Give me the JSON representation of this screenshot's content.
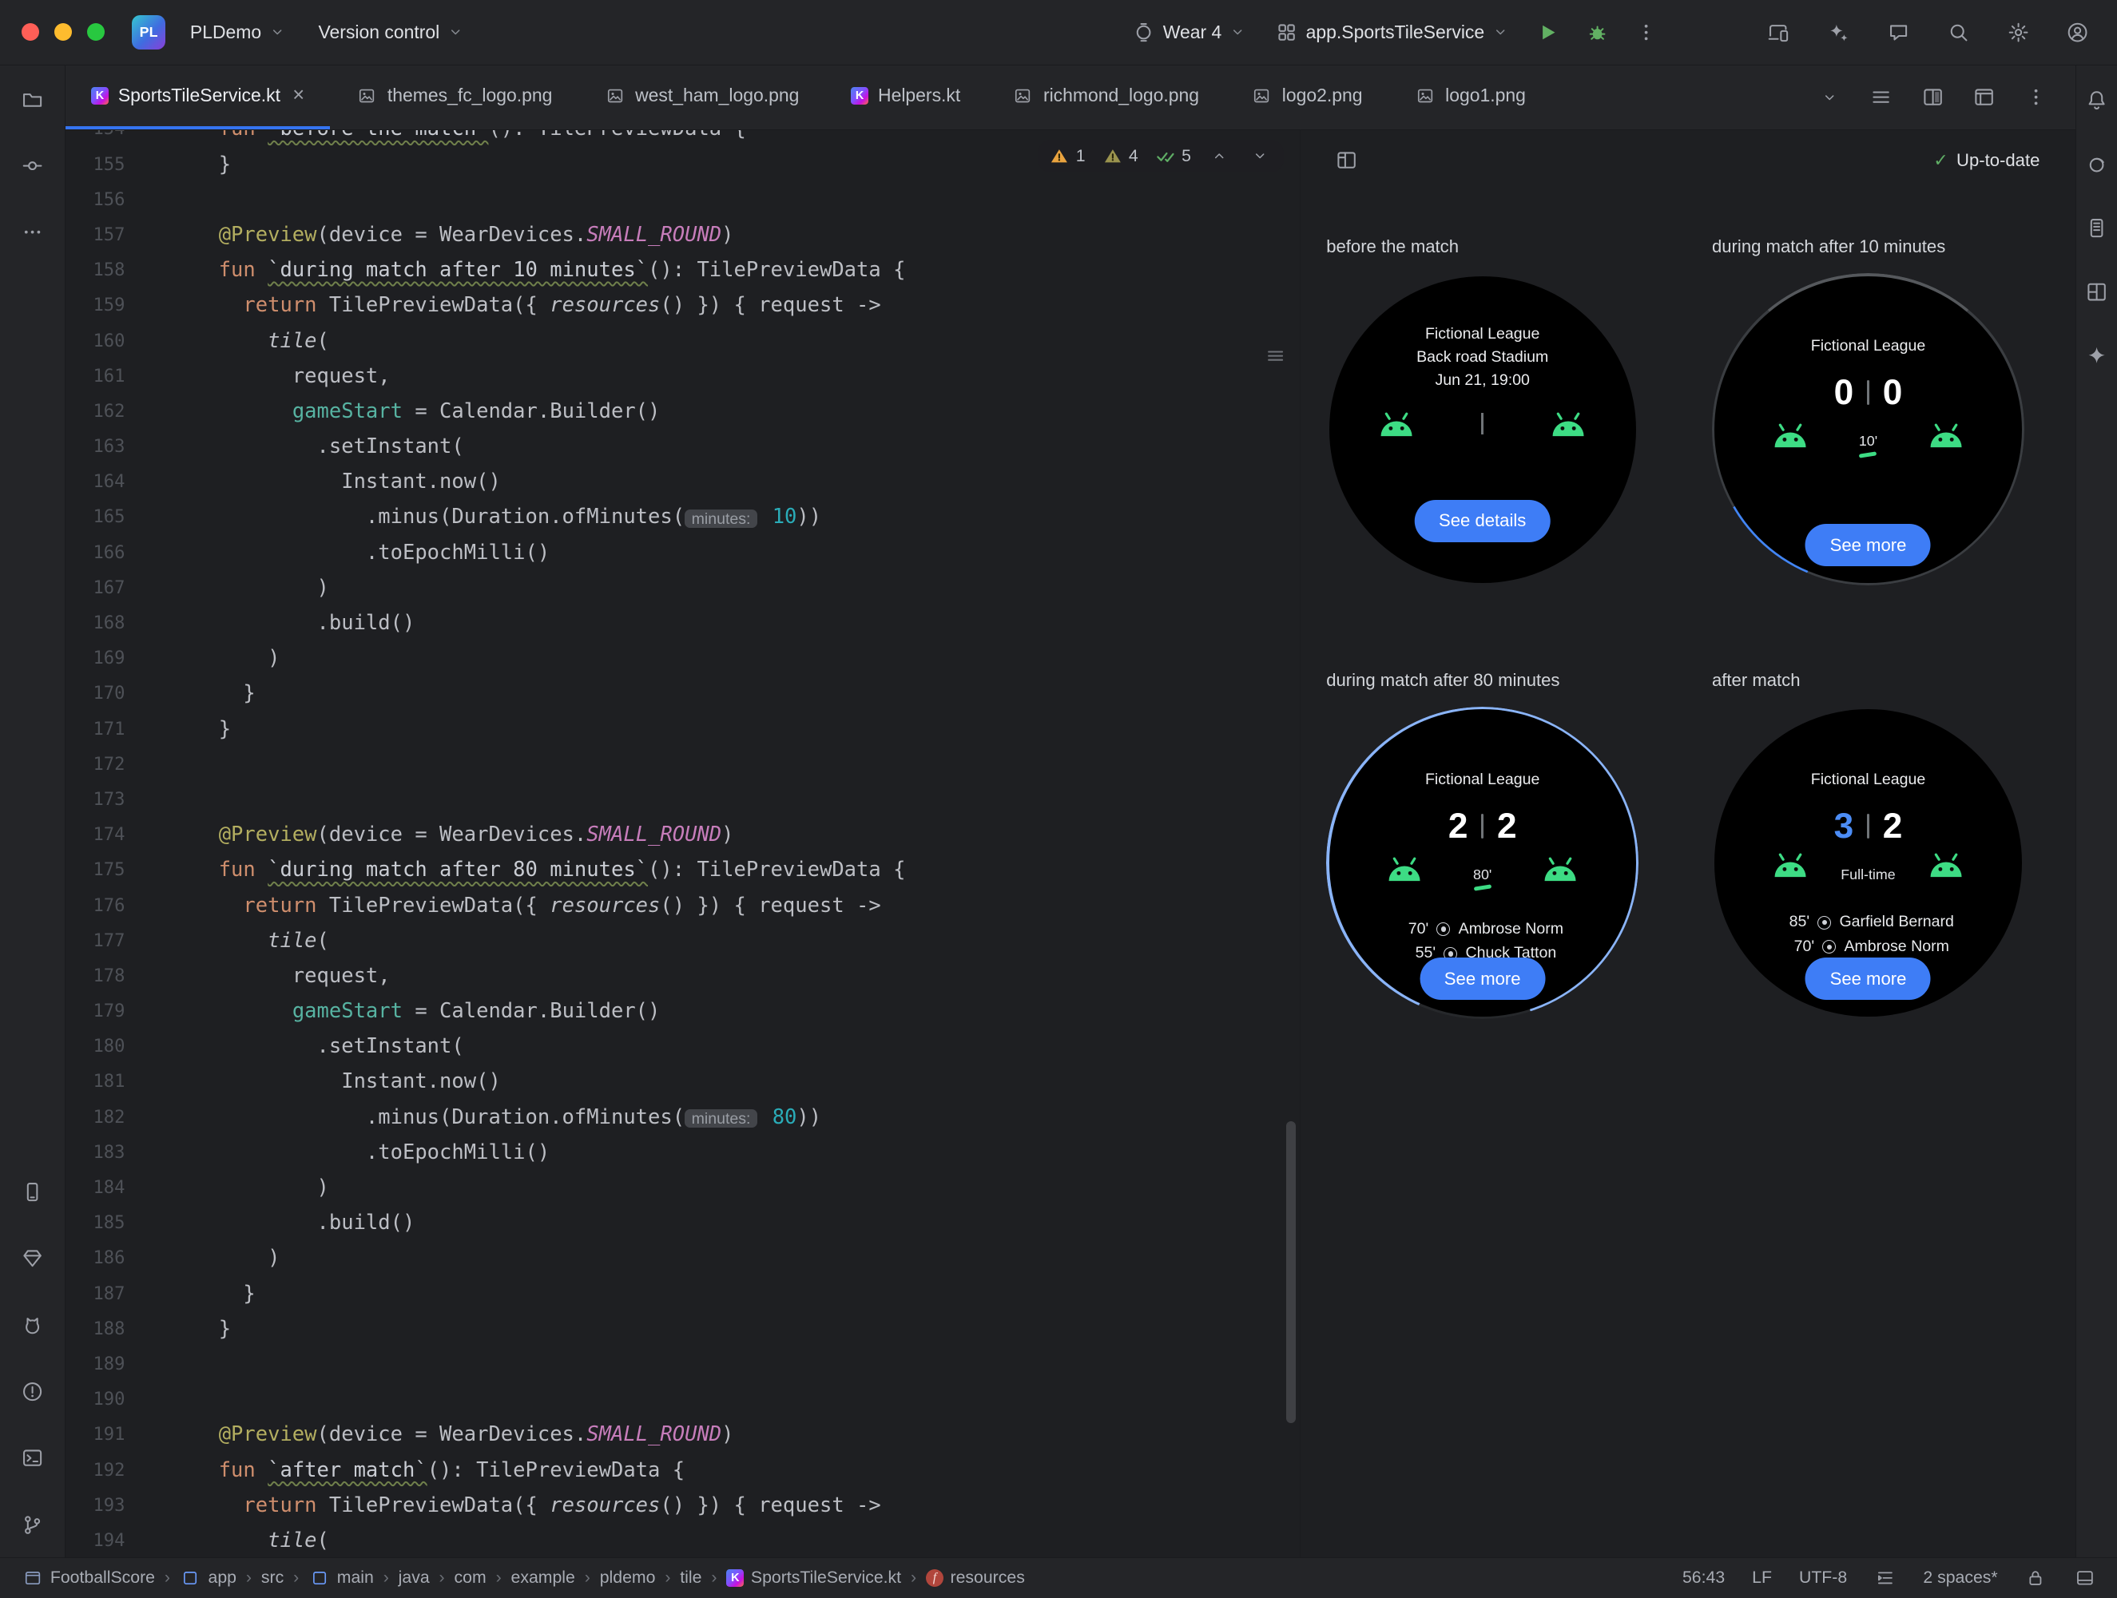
{
  "titlebar": {
    "project_logo": "PL",
    "project_name": "PLDemo",
    "vcs_menu": "Version control",
    "device_selector": "Wear 4",
    "run_config": "app.SportsTileService",
    "right_icons": [
      "device-mirroring",
      "ai-assistant",
      "feedback",
      "search",
      "settings",
      "avatar"
    ]
  },
  "left_toolbar": {
    "top": [
      "project-folder",
      "commit",
      "more"
    ],
    "bottom": [
      "running-devices",
      "app-quality-insights",
      "logcat",
      "problems",
      "terminal",
      "version-control"
    ]
  },
  "right_toolbar": [
    "notifications",
    "gradle",
    "device-explorer",
    "layout-inspector",
    "gemini"
  ],
  "tabbar": {
    "tabs": [
      {
        "label": "SportsTileService.kt",
        "icon": "kotlin",
        "active": true,
        "closable": true
      },
      {
        "label": "themes_fc_logo.png",
        "icon": "image"
      },
      {
        "label": "west_ham_logo.png",
        "icon": "image"
      },
      {
        "label": "Helpers.kt",
        "icon": "kotlin"
      },
      {
        "label": "richmond_logo.png",
        "icon": "image"
      },
      {
        "label": "logo2.png",
        "icon": "image"
      },
      {
        "label": "logo1.png",
        "icon": "image"
      }
    ],
    "right_icons": [
      "chevron-down",
      "editor-list",
      "split-editor",
      "design-preview",
      "more-vertical"
    ]
  },
  "editor": {
    "inspections": [
      {
        "icon": "warning",
        "count": "1"
      },
      {
        "icon": "weak-warning",
        "count": "4"
      },
      {
        "icon": "checks",
        "count": "5"
      }
    ],
    "lines": [
      {
        "n": 154,
        "t": [
          [
            "kw",
            "fun "
          ],
          [
            "fn",
            "`before the match`"
          ],
          [
            "p",
            "(): TilePreviewData {"
          ]
        ]
      },
      {
        "n": 155,
        "t": [
          [
            "p",
            "}"
          ]
        ]
      },
      {
        "n": 156,
        "t": []
      },
      {
        "n": 157,
        "t": [
          [
            "ann",
            "@Preview"
          ],
          [
            "p",
            "(device = WearDevices."
          ],
          [
            "cn",
            "SMALL_ROUND"
          ],
          [
            "p",
            ")"
          ]
        ]
      },
      {
        "n": 158,
        "t": [
          [
            "kw",
            "fun "
          ],
          [
            "fn",
            "`during match after 10 minutes`"
          ],
          [
            "p",
            "(): TilePreviewData {"
          ]
        ]
      },
      {
        "n": 159,
        "t": [
          [
            "p",
            "  "
          ],
          [
            "kw",
            "return "
          ],
          [
            "p",
            "TilePreviewData({ "
          ],
          [
            "it",
            "resources"
          ],
          [
            "p",
            "() }) { request ->"
          ]
        ]
      },
      {
        "n": 160,
        "t": [
          [
            "p",
            "    "
          ],
          [
            "it",
            "tile"
          ],
          [
            "p",
            "("
          ]
        ]
      },
      {
        "n": 161,
        "t": [
          [
            "p",
            "      request,"
          ]
        ]
      },
      {
        "n": 162,
        "t": [
          [
            "p",
            "      "
          ],
          [
            "nm",
            "gameStart"
          ],
          [
            "p",
            " = Calendar.Builder()"
          ]
        ]
      },
      {
        "n": 163,
        "t": [
          [
            "p",
            "        .setInstant("
          ]
        ]
      },
      {
        "n": 164,
        "t": [
          [
            "p",
            "          Instant.now()"
          ]
        ]
      },
      {
        "n": 165,
        "t": [
          [
            "p",
            "            .minus(Duration.ofMinutes("
          ],
          [
            "h",
            "minutes:"
          ],
          [
            "p",
            " "
          ],
          [
            "num",
            "10"
          ],
          [
            "p",
            "))"
          ]
        ]
      },
      {
        "n": 166,
        "t": [
          [
            "p",
            "            .toEpochMilli()"
          ]
        ]
      },
      {
        "n": 167,
        "t": [
          [
            "p",
            "        )"
          ]
        ]
      },
      {
        "n": 168,
        "t": [
          [
            "p",
            "        .build()"
          ]
        ]
      },
      {
        "n": 169,
        "t": [
          [
            "p",
            "    )"
          ]
        ]
      },
      {
        "n": 170,
        "t": [
          [
            "p",
            "  }"
          ]
        ]
      },
      {
        "n": 171,
        "t": [
          [
            "p",
            "}"
          ]
        ]
      },
      {
        "n": 172,
        "t": []
      },
      {
        "n": 173,
        "t": []
      },
      {
        "n": 174,
        "t": [
          [
            "ann",
            "@Preview"
          ],
          [
            "p",
            "(device = WearDevices."
          ],
          [
            "cn",
            "SMALL_ROUND"
          ],
          [
            "p",
            ")"
          ]
        ]
      },
      {
        "n": 175,
        "t": [
          [
            "kw",
            "fun "
          ],
          [
            "fn",
            "`during match after 80 minutes`"
          ],
          [
            "p",
            "(): TilePreviewData {"
          ]
        ]
      },
      {
        "n": 176,
        "t": [
          [
            "p",
            "  "
          ],
          [
            "kw",
            "return "
          ],
          [
            "p",
            "TilePreviewData({ "
          ],
          [
            "it",
            "resources"
          ],
          [
            "p",
            "() }) { request ->"
          ]
        ]
      },
      {
        "n": 177,
        "t": [
          [
            "p",
            "    "
          ],
          [
            "it",
            "tile"
          ],
          [
            "p",
            "("
          ]
        ]
      },
      {
        "n": 178,
        "t": [
          [
            "p",
            "      request,"
          ]
        ]
      },
      {
        "n": 179,
        "t": [
          [
            "p",
            "      "
          ],
          [
            "nm",
            "gameStart"
          ],
          [
            "p",
            " = Calendar.Builder()"
          ]
        ]
      },
      {
        "n": 180,
        "t": [
          [
            "p",
            "        .setInstant("
          ]
        ]
      },
      {
        "n": 181,
        "t": [
          [
            "p",
            "          Instant.now()"
          ]
        ]
      },
      {
        "n": 182,
        "t": [
          [
            "p",
            "            .minus(Duration.ofMinutes("
          ],
          [
            "h",
            "minutes:"
          ],
          [
            "p",
            " "
          ],
          [
            "num",
            "80"
          ],
          [
            "p",
            "))"
          ]
        ]
      },
      {
        "n": 183,
        "t": [
          [
            "p",
            "            .toEpochMilli()"
          ]
        ]
      },
      {
        "n": 184,
        "t": [
          [
            "p",
            "        )"
          ]
        ]
      },
      {
        "n": 185,
        "t": [
          [
            "p",
            "        .build()"
          ]
        ]
      },
      {
        "n": 186,
        "t": [
          [
            "p",
            "    )"
          ]
        ]
      },
      {
        "n": 187,
        "t": [
          [
            "p",
            "  }"
          ]
        ]
      },
      {
        "n": 188,
        "t": [
          [
            "p",
            "}"
          ]
        ]
      },
      {
        "n": 189,
        "t": []
      },
      {
        "n": 190,
        "t": []
      },
      {
        "n": 191,
        "t": [
          [
            "ann",
            "@Preview"
          ],
          [
            "p",
            "(device = WearDevices."
          ],
          [
            "cn",
            "SMALL_ROUND"
          ],
          [
            "p",
            ")"
          ]
        ]
      },
      {
        "n": 192,
        "t": [
          [
            "kw",
            "fun "
          ],
          [
            "fn",
            "`after match`"
          ],
          [
            "p",
            "(): TilePreviewData {"
          ]
        ]
      },
      {
        "n": 193,
        "t": [
          [
            "p",
            "  "
          ],
          [
            "kw",
            "return "
          ],
          [
            "p",
            "TilePreviewData({ "
          ],
          [
            "it",
            "resources"
          ],
          [
            "p",
            "() }) { request ->"
          ]
        ]
      },
      {
        "n": 194,
        "t": [
          [
            "p",
            "    "
          ],
          [
            "it",
            "tile"
          ],
          [
            "p",
            "("
          ]
        ]
      }
    ]
  },
  "preview": {
    "status": "Up-to-date",
    "header_icon": "preview-layout",
    "watches": [
      {
        "label": "before the match",
        "league": "Fictional League",
        "venue": "Back road Stadium",
        "datetime": "Jun 21, 19:00",
        "button": "See details",
        "ring": "none"
      },
      {
        "label": "during match after 10 minutes",
        "league": "Fictional League",
        "home": "0",
        "away": "0",
        "minute": "10'",
        "live": true,
        "button": "See more",
        "ring": "early"
      },
      {
        "label": "during match after 80 minutes",
        "league": "Fictional League",
        "home": "2",
        "away": "2",
        "minute": "80'",
        "live": true,
        "scorers": [
          {
            "minute": "70'",
            "player": "Ambrose Norm"
          },
          {
            "minute": "55'",
            "player": "Chuck Tatton"
          }
        ],
        "button": "See more",
        "ring": "late"
      },
      {
        "label": "after match",
        "league": "Fictional League",
        "home": "3",
        "away": "2",
        "home_highlight": true,
        "minute": "Full-time",
        "live": false,
        "scorers": [
          {
            "minute": "85'",
            "player": "Garfield Bernard"
          },
          {
            "minute": "70'",
            "player": "Ambrose Norm"
          }
        ],
        "button": "See more",
        "ring": "none"
      }
    ]
  },
  "statusbar": {
    "breadcrumbs": [
      {
        "label": "FootballScore",
        "icon": "project-window"
      },
      {
        "label": "app",
        "icon": "module"
      },
      {
        "label": "src"
      },
      {
        "label": "main",
        "icon": "module"
      },
      {
        "label": "java"
      },
      {
        "label": "com"
      },
      {
        "label": "example"
      },
      {
        "label": "pldemo"
      },
      {
        "label": "tile"
      },
      {
        "label": "SportsTileService.kt",
        "icon": "kotlin"
      },
      {
        "label": "resources",
        "icon": "resources-function"
      }
    ],
    "right": [
      {
        "t": "text",
        "v": "56:43",
        "name": "caret-position"
      },
      {
        "t": "text",
        "v": "LF",
        "name": "line-separator"
      },
      {
        "t": "text",
        "v": "UTF-8",
        "name": "file-encoding"
      },
      {
        "t": "icon",
        "v": "indent-style",
        "name": "indent-style"
      },
      {
        "t": "text",
        "v": "2 spaces*",
        "name": "indent-size"
      },
      {
        "t": "icon",
        "v": "readonly-lock",
        "name": "readonly-toggle"
      },
      {
        "t": "icon",
        "v": "window-layout",
        "name": "layout-widget"
      }
    ]
  }
}
